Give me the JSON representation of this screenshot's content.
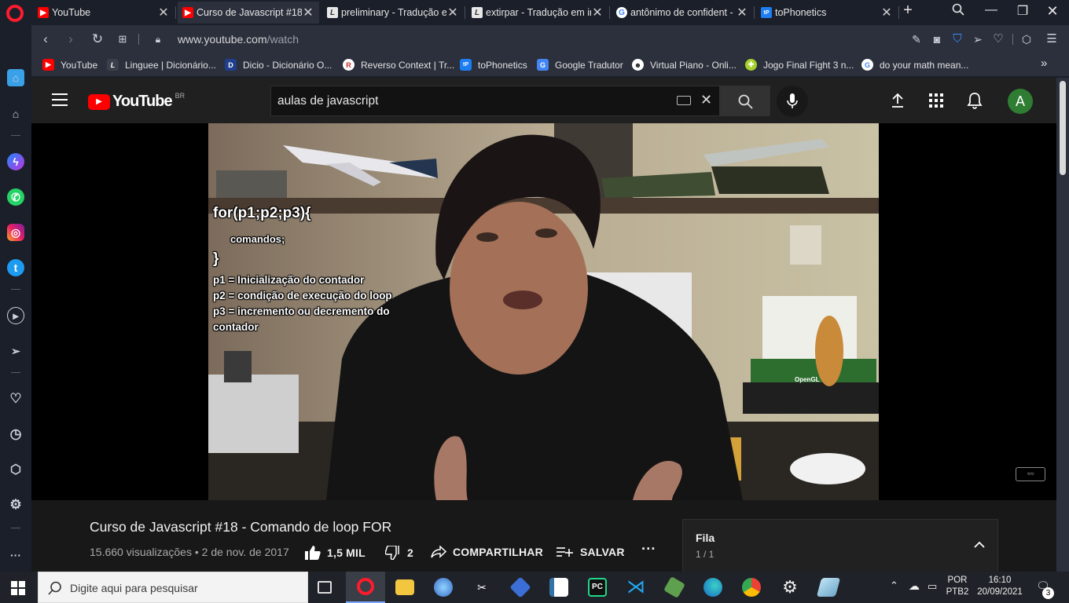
{
  "tabs": [
    {
      "label": "YouTube",
      "favicon": "youtube-icon",
      "active": false
    },
    {
      "label": "Curso de Javascript #18",
      "favicon": "youtube-icon",
      "active": true
    },
    {
      "label": "preliminary - Tradução e",
      "favicon": "linguee-icon",
      "active": false
    },
    {
      "label": "extirpar - Tradução em ir",
      "favicon": "linguee-icon",
      "active": false
    },
    {
      "label": "antônimo de confident -",
      "favicon": "google-icon",
      "active": false
    },
    {
      "label": "toPhonetics",
      "favicon": "tophonetics-icon",
      "active": false
    }
  ],
  "address": {
    "host": "www.youtube.com",
    "path": "/watch"
  },
  "bookmarks": [
    {
      "label": "YouTube",
      "color": "#ff0000"
    },
    {
      "label": "Linguee | Dicionário...",
      "color": "#3a3f4a"
    },
    {
      "label": "Dicio - Dicionário O...",
      "color": "#1f3e8c"
    },
    {
      "label": "Reverso Context | Tr...",
      "color": "#ffffff"
    },
    {
      "label": "toPhonetics",
      "color": "#1c7ef2"
    },
    {
      "label": "Google Tradutor",
      "color": "#4285f4"
    },
    {
      "label": "Virtual Piano - Onli...",
      "color": "#ffffff"
    },
    {
      "label": "Jogo Final Fight 3 n...",
      "color": "#a6d12c"
    },
    {
      "label": "do your math mean...",
      "color": "#ffffff"
    }
  ],
  "youtube": {
    "logo_text": "YouTube",
    "region": "BR",
    "search_value": "aulas de javascript",
    "avatar_letter": "A",
    "avatar_color": "#2e7d32",
    "video_overlay": {
      "line1": "for(p1;p2;p3){",
      "line2": "comandos;",
      "line3": "}",
      "line4": "p1 = Inicialização do contador",
      "line5": "p2 = condição de execução do loop",
      "line6": "p3 = incremento ou decremento do",
      "line7": "contador",
      "book_label": "OpenGL"
    },
    "video_title": "Curso de Javascript #18 - Comando de loop FOR",
    "views": "15.660 visualizações",
    "date": "2 de nov. de 2017",
    "likes": "1,5 MIL",
    "dislikes": "2",
    "share_label": "COMPARTILHAR",
    "save_label": "SALVAR",
    "queue_title": "Fila",
    "queue_count": "1 / 1"
  },
  "taskbar": {
    "search_placeholder": "Digite aqui para pesquisar",
    "lang_top": "POR",
    "lang_bottom": "PTB2",
    "time": "16:10",
    "date": "20/09/2021",
    "notifications": "3"
  },
  "colors": {
    "youtube_red": "#ff0000",
    "opera_red": "#ff1b2d",
    "dark_bg": "#181818"
  }
}
